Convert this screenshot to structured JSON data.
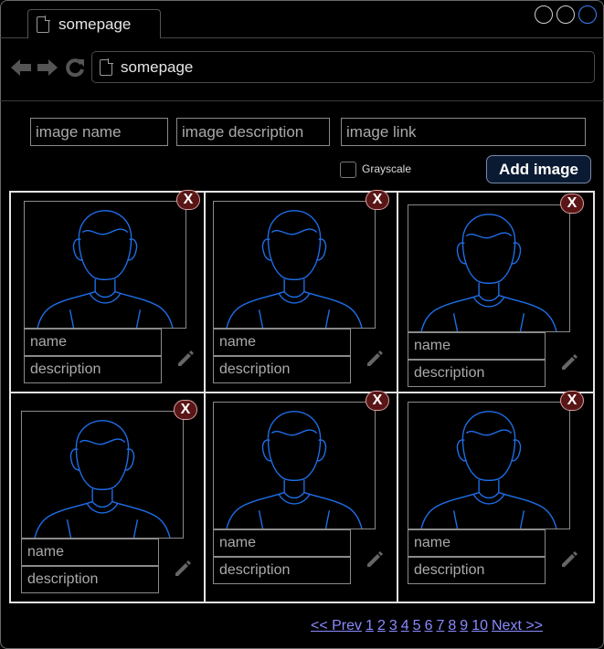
{
  "browser": {
    "tab_title": "somepage",
    "address_text": "somepage",
    "icons": {
      "back": "left-arrow-icon",
      "forward": "right-arrow-icon",
      "reload": "reload-icon",
      "page": "document-icon"
    }
  },
  "form": {
    "name_placeholder": "image name",
    "description_placeholder": "image description",
    "link_placeholder": "image link",
    "grayscale_label": "Grayscale",
    "add_button_label": "Add image"
  },
  "cards": [
    {
      "name_placeholder": "name",
      "description_placeholder": "description",
      "delete_label": "X"
    },
    {
      "name_placeholder": "name",
      "description_placeholder": "description",
      "delete_label": "X"
    },
    {
      "name_placeholder": "name",
      "description_placeholder": "description",
      "delete_label": "X"
    },
    {
      "name_placeholder": "name",
      "description_placeholder": "description",
      "delete_label": "X"
    },
    {
      "name_placeholder": "name",
      "description_placeholder": "description",
      "delete_label": "X"
    },
    {
      "name_placeholder": "name",
      "description_placeholder": "description",
      "delete_label": "X"
    }
  ],
  "pagination": {
    "prev_label": "<< Prev",
    "pages": [
      "1",
      "2",
      "3",
      "4",
      "5",
      "6",
      "7",
      "8",
      "9",
      "10"
    ],
    "next_label": "Next >>"
  },
  "colors": {
    "avatar_line": "#1e6ee8",
    "delete_button": "#5a1616",
    "add_button": "#0b1a33",
    "link": "#8a8aff"
  }
}
